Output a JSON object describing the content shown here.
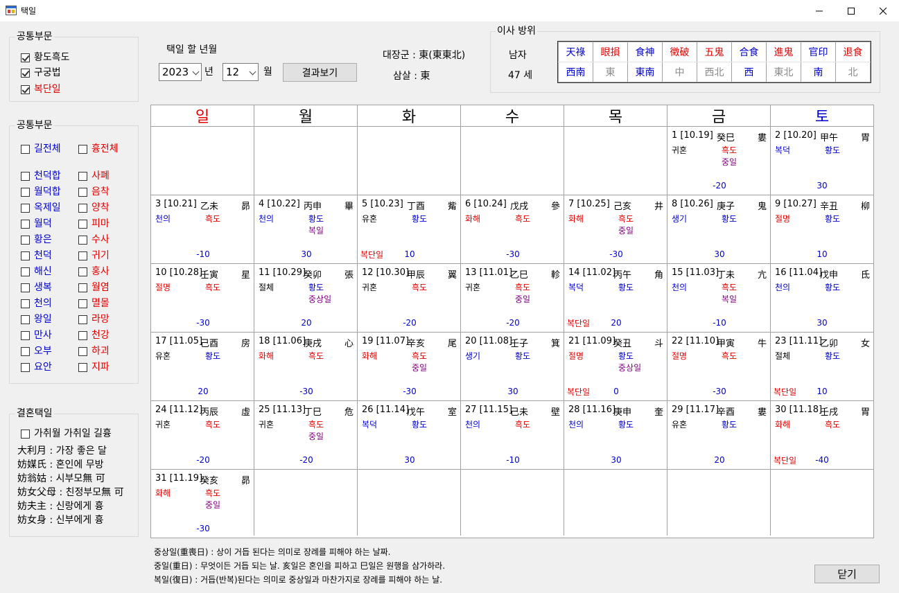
{
  "window": {
    "title": "택일"
  },
  "group1": {
    "title": "공통부문",
    "items": [
      {
        "label": "황도흑도",
        "checked": true,
        "color": "black"
      },
      {
        "label": "구궁법",
        "checked": true,
        "color": "black"
      },
      {
        "label": "복단일",
        "checked": true,
        "color": "red"
      }
    ]
  },
  "group2": {
    "title": "공통부문",
    "top_left": {
      "label": "길전체",
      "color": "blue"
    },
    "top_right": {
      "label": "흉전체",
      "color": "red"
    },
    "left": [
      "천덕합",
      "월덕합",
      "옥제일",
      "월덕",
      "황은",
      "천덕",
      "해신",
      "생복",
      "천의",
      "왕일",
      "만사",
      "오부",
      "요안"
    ],
    "right": [
      "사폐",
      "음착",
      "양착",
      "피마",
      "수사",
      "귀기",
      "홍사",
      "월염",
      "멸몰",
      "라망",
      "천강",
      "하괴",
      "지파"
    ]
  },
  "group3": {
    "title": "결혼택일",
    "checkbox": "가취월 가취일 길흉",
    "lines": [
      "大利月 : 가장 좋은 달",
      "妨媒氏 : 혼인에 무방",
      "妨翁姑 : 시부모無 可",
      "妨女父母 : 친정부모無 可",
      "妨夫主 : 신랑에게 흉",
      "妨女身 : 신부에게 흉"
    ]
  },
  "selector": {
    "heading": "택일 할 년월",
    "year": "2023",
    "year_unit": "년",
    "month": "12",
    "month_unit": "월",
    "button": "결과보기"
  },
  "info": {
    "daejang": "대장군 : 東(東東北)",
    "samsal": "삼살 : 東"
  },
  "move": {
    "title": "이사 방위",
    "gender": "남자",
    "age": "47 세",
    "directions": [
      {
        "top": "天祿",
        "tc": "blue",
        "bottom": "西南",
        "bc": "blue"
      },
      {
        "top": "眼損",
        "tc": "red",
        "bottom": "東",
        "bc": "gray"
      },
      {
        "top": "食神",
        "tc": "blue",
        "bottom": "東南",
        "bc": "blue"
      },
      {
        "top": "徵破",
        "tc": "red",
        "bottom": "中",
        "bc": "gray"
      },
      {
        "top": "五鬼",
        "tc": "red",
        "bottom": "西北",
        "bc": "gray"
      },
      {
        "top": "合食",
        "tc": "blue",
        "bottom": "西",
        "bc": "blue"
      },
      {
        "top": "進鬼",
        "tc": "red",
        "bottom": "東北",
        "bc": "gray"
      },
      {
        "top": "官印",
        "tc": "blue",
        "bottom": "南",
        "bc": "blue"
      },
      {
        "top": "退食",
        "tc": "red",
        "bottom": "北",
        "bc": "gray"
      }
    ]
  },
  "weekdays": [
    {
      "label": "일",
      "color": "red"
    },
    {
      "label": "월",
      "color": "black"
    },
    {
      "label": "화",
      "color": "black"
    },
    {
      "label": "수",
      "color": "black"
    },
    {
      "label": "목",
      "color": "black"
    },
    {
      "label": "금",
      "color": "black"
    },
    {
      "label": "토",
      "color": "blue"
    }
  ],
  "calendar": [
    {
      "pos": 5,
      "date": "1 [10.19]",
      "gj": "癸巳",
      "star": "婁",
      "a": "귀혼",
      "ac": "black",
      "b": "흑도",
      "bc": "red",
      "c": "중일",
      "bokdan": "",
      "score": "-20"
    },
    {
      "pos": 6,
      "date": "2 [10.20]",
      "gj": "甲午",
      "star": "胃",
      "a": "복덕",
      "ac": "blue",
      "b": "황도",
      "bc": "blue",
      "c": "",
      "bokdan": "",
      "score": "30"
    },
    {
      "pos": 7,
      "date": "3 [10.21]",
      "gj": "乙未",
      "star": "昴",
      "a": "천의",
      "ac": "blue",
      "b": "흑도",
      "bc": "red",
      "c": "",
      "bokdan": "",
      "score": "-10"
    },
    {
      "pos": 8,
      "date": "4 [10.22]",
      "gj": "丙申",
      "star": "畢",
      "a": "천의",
      "ac": "blue",
      "b": "황도",
      "bc": "blue",
      "c": "복일",
      "bokdan": "",
      "score": "30"
    },
    {
      "pos": 9,
      "date": "5 [10.23]",
      "gj": "丁酉",
      "star": "觜",
      "a": "유혼",
      "ac": "black",
      "b": "황도",
      "bc": "blue",
      "c": "",
      "bokdan": "복단일",
      "score": "10"
    },
    {
      "pos": 10,
      "date": "6 [10.24]",
      "gj": "戊戌",
      "star": "參",
      "a": "화해",
      "ac": "red",
      "b": "흑도",
      "bc": "red",
      "c": "",
      "bokdan": "",
      "score": "-30"
    },
    {
      "pos": 11,
      "date": "7 [10.25]",
      "gj": "己亥",
      "star": "井",
      "a": "화해",
      "ac": "red",
      "b": "흑도",
      "bc": "red",
      "c": "중일",
      "bokdan": "",
      "score": "-30"
    },
    {
      "pos": 12,
      "date": "8 [10.26]",
      "gj": "庚子",
      "star": "鬼",
      "a": "생기",
      "ac": "blue",
      "b": "황도",
      "bc": "blue",
      "c": "",
      "bokdan": "",
      "score": "30"
    },
    {
      "pos": 13,
      "date": "9 [10.27]",
      "gj": "辛丑",
      "star": "柳",
      "a": "절명",
      "ac": "red",
      "b": "황도",
      "bc": "blue",
      "c": "",
      "bokdan": "",
      "score": "10"
    },
    {
      "pos": 14,
      "date": "10 [10.28]",
      "gj": "壬寅",
      "star": "星",
      "a": "절명",
      "ac": "red",
      "b": "흑도",
      "bc": "red",
      "c": "",
      "bokdan": "",
      "score": "-30"
    },
    {
      "pos": 15,
      "date": "11 [10.29]",
      "gj": "癸卯",
      "star": "張",
      "a": "절체",
      "ac": "black",
      "b": "황도",
      "bc": "blue",
      "c": "중상일",
      "bokdan": "",
      "score": "20"
    },
    {
      "pos": 16,
      "date": "12 [10.30]",
      "gj": "甲辰",
      "star": "翼",
      "a": "귀혼",
      "ac": "black",
      "b": "흑도",
      "bc": "red",
      "c": "",
      "bokdan": "",
      "score": "-20"
    },
    {
      "pos": 17,
      "date": "13 [11.01]",
      "gj": "乙巳",
      "star": "軫",
      "a": "귀혼",
      "ac": "black",
      "b": "흑도",
      "bc": "red",
      "c": "중일",
      "bokdan": "",
      "score": "-20"
    },
    {
      "pos": 18,
      "date": "14 [11.02]",
      "gj": "丙午",
      "star": "角",
      "a": "복덕",
      "ac": "blue",
      "b": "황도",
      "bc": "blue",
      "c": "",
      "bokdan": "복단일",
      "score": "20"
    },
    {
      "pos": 19,
      "date": "15 [11.03]",
      "gj": "丁未",
      "star": "亢",
      "a": "천의",
      "ac": "blue",
      "b": "흑도",
      "bc": "red",
      "c": "복일",
      "bokdan": "",
      "score": "-10"
    },
    {
      "pos": 20,
      "date": "16 [11.04]",
      "gj": "戊申",
      "star": "氐",
      "a": "천의",
      "ac": "blue",
      "b": "황도",
      "bc": "blue",
      "c": "",
      "bokdan": "",
      "score": "30"
    },
    {
      "pos": 21,
      "date": "17 [11.05]",
      "gj": "己酉",
      "star": "房",
      "a": "유혼",
      "ac": "black",
      "b": "황도",
      "bc": "blue",
      "c": "",
      "bokdan": "",
      "score": "20"
    },
    {
      "pos": 22,
      "date": "18 [11.06]",
      "gj": "庚戌",
      "star": "心",
      "a": "화해",
      "ac": "red",
      "b": "흑도",
      "bc": "red",
      "c": "",
      "bokdan": "",
      "score": "-30"
    },
    {
      "pos": 23,
      "date": "19 [11.07]",
      "gj": "辛亥",
      "star": "尾",
      "a": "화해",
      "ac": "red",
      "b": "흑도",
      "bc": "red",
      "c": "중일",
      "bokdan": "",
      "score": "-30"
    },
    {
      "pos": 24,
      "date": "20 [11.08]",
      "gj": "壬子",
      "star": "箕",
      "a": "생기",
      "ac": "blue",
      "b": "황도",
      "bc": "blue",
      "c": "",
      "bokdan": "",
      "score": "30"
    },
    {
      "pos": 25,
      "date": "21 [11.09]",
      "gj": "癸丑",
      "star": "斗",
      "a": "절명",
      "ac": "red",
      "b": "황도",
      "bc": "blue",
      "c": "중상일",
      "bokdan": "복단일",
      "score": "0"
    },
    {
      "pos": 26,
      "date": "22 [11.10]",
      "gj": "甲寅",
      "star": "牛",
      "a": "절명",
      "ac": "red",
      "b": "흑도",
      "bc": "red",
      "c": "",
      "bokdan": "",
      "score": "-30"
    },
    {
      "pos": 27,
      "date": "23 [11.11]",
      "gj": "乙卯",
      "star": "女",
      "a": "절체",
      "ac": "black",
      "b": "황도",
      "bc": "blue",
      "c": "",
      "bokdan": "복단일",
      "score": "10"
    },
    {
      "pos": 28,
      "date": "24 [11.12]",
      "gj": "丙辰",
      "star": "虛",
      "a": "귀혼",
      "ac": "black",
      "b": "흑도",
      "bc": "red",
      "c": "",
      "bokdan": "",
      "score": "-20"
    },
    {
      "pos": 29,
      "date": "25 [11.13]",
      "gj": "丁巳",
      "star": "危",
      "a": "귀혼",
      "ac": "black",
      "b": "흑도",
      "bc": "red",
      "c": "중일",
      "bokdan": "",
      "score": "-20"
    },
    {
      "pos": 30,
      "date": "26 [11.14]",
      "gj": "戊午",
      "star": "室",
      "a": "복덕",
      "ac": "blue",
      "b": "황도",
      "bc": "blue",
      "c": "",
      "bokdan": "",
      "score": "30"
    },
    {
      "pos": 31,
      "date": "27 [11.15]",
      "gj": "己未",
      "star": "壁",
      "a": "천의",
      "ac": "blue",
      "b": "흑도",
      "bc": "red",
      "c": "",
      "bokdan": "",
      "score": "-10"
    },
    {
      "pos": 32,
      "date": "28 [11.16]",
      "gj": "庚申",
      "star": "奎",
      "a": "천의",
      "ac": "blue",
      "b": "황도",
      "bc": "blue",
      "c": "",
      "bokdan": "",
      "score": "30"
    },
    {
      "pos": 33,
      "date": "29 [11.17]",
      "gj": "辛酉",
      "star": "婁",
      "a": "유혼",
      "ac": "black",
      "b": "황도",
      "bc": "blue",
      "c": "",
      "bokdan": "",
      "score": "20"
    },
    {
      "pos": 34,
      "date": "30 [11.18]",
      "gj": "壬戌",
      "star": "胃",
      "a": "화해",
      "ac": "red",
      "b": "흑도",
      "bc": "red",
      "c": "",
      "bokdan": "복단일",
      "score": "-40"
    },
    {
      "pos": 35,
      "date": "31 [11.19]",
      "gj": "癸亥",
      "star": "昴",
      "a": "화해",
      "ac": "red",
      "b": "흑도",
      "bc": "red",
      "c": "중일",
      "bokdan": "",
      "score": "-30"
    }
  ],
  "notes": [
    "중상일(重喪日) : 상이 거듭 된다는 의미로 장례를 피해야 하는 날짜.",
    "중일(重日) : 무엇이든 거듭 되는 날. 亥일은 혼인을 피하고 巳일은 원행을 삼가하라.",
    "복일(復日) : 거듭(반복)된다는 의미로 중상일과 마찬가지로 장례를 피해야 하는 날."
  ],
  "close_button": "닫기"
}
